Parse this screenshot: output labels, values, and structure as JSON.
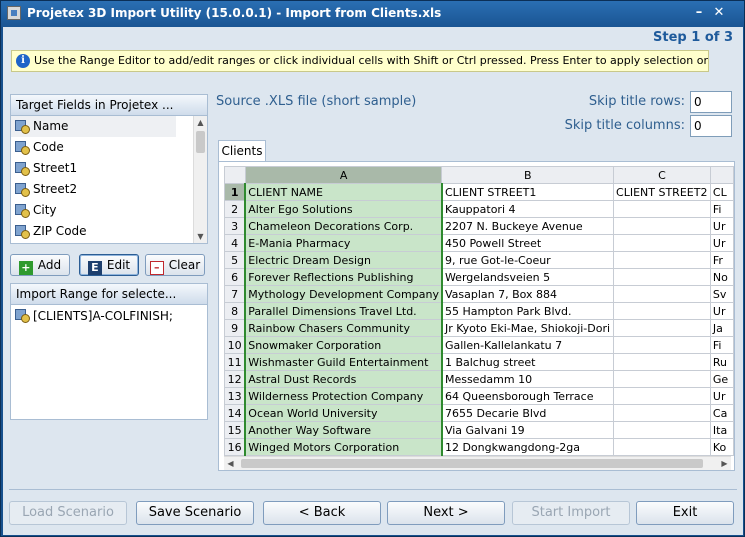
{
  "window": {
    "title": "Projetex 3D Import Utility  (15.0.0.1) - Import from Clients.xls",
    "minimize_glyph": "–",
    "close_glyph": "✕"
  },
  "step": "Step 1 of 3",
  "info": {
    "icon": "info-icon",
    "icon_glyph": "i",
    "text": "Use the Range Editor to add/edit ranges or click individual cells with Shift or Ctrl pressed. Press Enter to apply selection or Escape to cancel."
  },
  "target_fields": {
    "header": "Target Fields in Projetex ...",
    "items": [
      "Name",
      "Code",
      "Street1",
      "Street2",
      "City",
      "ZIP Code"
    ],
    "selected": "Name"
  },
  "range_buttons": {
    "add": "Add",
    "edit": "Edit",
    "clear": "Clear",
    "add_glyph": "+",
    "edit_glyph": "E",
    "clear_glyph": "–"
  },
  "import_range": {
    "header": "Import Range for selecte...",
    "items": [
      "[CLIENTS]A-COLFINISH;"
    ]
  },
  "source": {
    "label": "Source .XLS file (short sample)",
    "skip_rows_label": "Skip title rows:",
    "skip_rows_value": "0",
    "skip_cols_label": "Skip title columns:",
    "skip_cols_value": "0"
  },
  "sheet_tab": "Clients",
  "grid": {
    "columns": [
      "A",
      "B",
      "C",
      ""
    ],
    "rows": [
      {
        "num": "1",
        "cells": [
          "CLIENT NAME",
          "CLIENT STREET1",
          "CLIENT STREET2",
          "CL"
        ]
      },
      {
        "num": "2",
        "cells": [
          "Alter Ego Solutions",
          "Kauppatori 4",
          "",
          "Fi"
        ]
      },
      {
        "num": "3",
        "cells": [
          "Chameleon Decorations Corp.",
          "2207 N. Buckeye Avenue",
          "",
          "Ur"
        ]
      },
      {
        "num": "4",
        "cells": [
          "E-Mania Pharmacy",
          "450 Powell Street",
          "",
          "Ur"
        ]
      },
      {
        "num": "5",
        "cells": [
          "Electric Dream Design",
          "9, rue Got-le-Coeur",
          "",
          "Fr"
        ]
      },
      {
        "num": "6",
        "cells": [
          "Forever Reflections Publishing",
          "Wergelandsveien 5",
          "",
          "No"
        ]
      },
      {
        "num": "7",
        "cells": [
          "Mythology Development Company",
          "Vasaplan 7, Box 884",
          "",
          "Sv"
        ]
      },
      {
        "num": "8",
        "cells": [
          "Parallel Dimensions Travel Ltd.",
          "55 Hampton Park Blvd.",
          "",
          "Ur"
        ]
      },
      {
        "num": "9",
        "cells": [
          "Rainbow Chasers Community",
          "Jr Kyoto Eki-Mae, Shiokoji-Dori",
          "",
          "Ja"
        ]
      },
      {
        "num": "10",
        "cells": [
          "Snowmaker Corporation",
          "Gallen-Kallelankatu 7",
          "",
          "Fi"
        ]
      },
      {
        "num": "11",
        "cells": [
          "Wishmaster Guild Entertainment",
          "1 Balchug street",
          "",
          "Ru"
        ]
      },
      {
        "num": "12",
        "cells": [
          "Astral Dust Records",
          "Messedamm 10",
          "",
          "Ge"
        ]
      },
      {
        "num": "13",
        "cells": [
          "Wilderness Protection Company",
          "64 Queensborough Terrace",
          "",
          "Ur"
        ]
      },
      {
        "num": "14",
        "cells": [
          "Ocean World University",
          "7655 Decarie Blvd",
          "",
          "Ca"
        ]
      },
      {
        "num": "15",
        "cells": [
          "Another Way Software",
          "Via Galvani 19",
          "",
          "Ita"
        ]
      },
      {
        "num": "16",
        "cells": [
          "Winged Motors Corporation",
          "12 Dongkwangdong-2ga",
          "",
          "Ko"
        ]
      }
    ]
  },
  "footer": {
    "load": "Load Scenario",
    "save": "Save Scenario",
    "back": "< Back",
    "next": "Next >",
    "start": "Start Import",
    "exit": "Exit"
  },
  "colors": {
    "title_bar": "#1a5593",
    "client_bg": "#dde6ef",
    "selected_column": "#c9e5c9",
    "selected_column_border": "#2f8a2f",
    "step_text": "#1e5a9b",
    "info_bg": "#ffffcc"
  }
}
